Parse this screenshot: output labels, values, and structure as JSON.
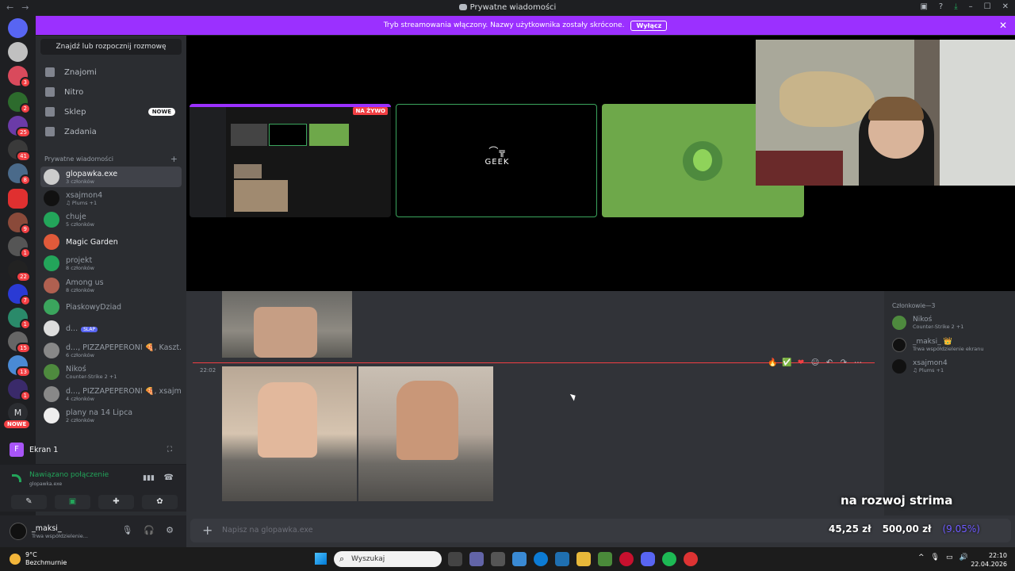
{
  "titlebar": {
    "back": "←",
    "forward": "→",
    "title": "Prywatne wiadomości",
    "right_icons": [
      "inbox-icon",
      "help-icon",
      "download-icon",
      "minimize-icon",
      "maximize-icon",
      "close-icon"
    ],
    "controls": [
      "–",
      "☐",
      "✕"
    ]
  },
  "banner": {
    "text": "Tryb streamowania włączony. Nazwy użytkownika zostały skrócone.",
    "button": "Wyłącz",
    "close": "✕",
    "color": "#9b30ff"
  },
  "guilds": {
    "badges": [
      "3",
      "2",
      "25",
      "41",
      "8",
      "9",
      "1",
      "22",
      "7",
      "1",
      "15",
      "13",
      "1"
    ],
    "m_label": "M",
    "new_label": "NOWE"
  },
  "sidebar": {
    "search_label": "Znajdź lub rozpocznij rozmowę",
    "nav": [
      {
        "label": "Znajomi"
      },
      {
        "label": "Nitro"
      },
      {
        "label": "Sklep",
        "badge": "NOWE"
      },
      {
        "label": "Zadania"
      }
    ],
    "dm_header": "Prywatne wiadomości",
    "dm_add": "+",
    "dms": [
      {
        "name": "glopawka.exe",
        "sub": "3 członków"
      },
      {
        "name": "xsajmon4",
        "sub": "♫ Plums +1"
      },
      {
        "name": "chuje",
        "sub": "5 członków"
      },
      {
        "name": "Magic Garden",
        "sub": ""
      },
      {
        "name": "projekt",
        "sub": "8 członków"
      },
      {
        "name": "Among us",
        "sub": "8 członków"
      },
      {
        "name": "PiaskowyDziad",
        "sub": ""
      },
      {
        "name": "d...",
        "sub": "",
        "tag": "SLAP"
      },
      {
        "name": "d..., PIZZAPEPERONI 🍕, Kaszt...",
        "sub": "6 członków"
      },
      {
        "name": "Nikoś",
        "sub": "Counter-Strike 2 +1"
      },
      {
        "name": "d..., PIZZAPEPERONI 🍕, xsajm...",
        "sub": "4 członków"
      },
      {
        "name": "plany na 14 Lipca",
        "sub": "2 członków"
      }
    ]
  },
  "stream_panel": {
    "avatar_letter": "F",
    "label": "Ekran 1",
    "close": "⛶"
  },
  "voice": {
    "status": "Nawiązano połączenie",
    "channel": "glopawka.exe",
    "buttons": [
      "✎",
      "▣",
      "✚",
      "✿"
    ],
    "sound_icon": "▮▮▮",
    "hangup_icon": "☎"
  },
  "user": {
    "name": "_maksi_",
    "status": "Trwa współdzielenie...",
    "mic": "🎙",
    "headset": "🎧",
    "settings": "⚙"
  },
  "stage": {
    "live_label": "NA ŻYWO",
    "geek_mark": "⌒╦",
    "geek_text": "GEEK"
  },
  "chat": {
    "timestamp": "22:02",
    "reactions": [
      "🔥",
      "✅",
      "❤",
      "☺",
      "↶",
      "↷",
      "⋯"
    ]
  },
  "members": {
    "header": "Członkowie—3",
    "list": [
      {
        "name": "Nikoś",
        "sub": "Counter-Strike 2 +1"
      },
      {
        "name": "_maksi_ 👑",
        "sub": "Trwa współdzielenie ekranu"
      },
      {
        "name": "xsajmon4",
        "sub": "♫ Plums +1"
      }
    ]
  },
  "composer": {
    "plus": "+",
    "placeholder": "Napisz na glopawka.exe"
  },
  "overlay": {
    "donation_current": "45,25 zł",
    "donation_goal": "500,00 zł",
    "donation_pct": "(9.05%)",
    "goal_text": "na rozwoj strima",
    "progress": 0.0905
  },
  "taskbar": {
    "temperature": "9°C",
    "weather": "Bezchmurnie",
    "search_placeholder": "Wyszukaj",
    "time": "22:10",
    "date": "22.04.2026",
    "tray": [
      "^",
      "🎙",
      "▭",
      "🔊"
    ]
  }
}
